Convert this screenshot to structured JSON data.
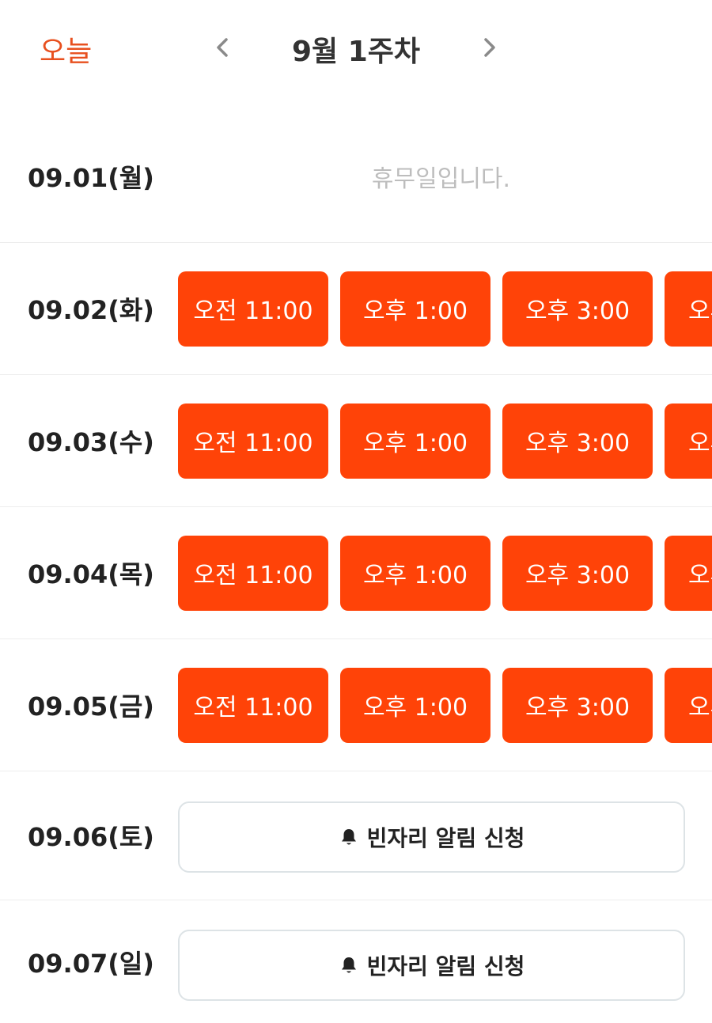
{
  "header": {
    "today_label": "오늘",
    "week_title": "9월 1주차",
    "prev_icon": "chevron-left-icon",
    "next_icon": "chevron-right-icon"
  },
  "colors": {
    "accent": "#ff4308",
    "today_text": "#e8501f",
    "closed_text": "#bdbdbd"
  },
  "days": [
    {
      "date": "09.01(월)",
      "status": "closed",
      "closed_text": "휴무일입니다."
    },
    {
      "date": "09.02(화)",
      "status": "open",
      "slots": [
        "오전 11:00",
        "오후 1:00",
        "오후 3:00",
        "오후"
      ]
    },
    {
      "date": "09.03(수)",
      "status": "open",
      "slots": [
        "오전 11:00",
        "오후 1:00",
        "오후 3:00",
        "오후"
      ]
    },
    {
      "date": "09.04(목)",
      "status": "open",
      "slots": [
        "오전 11:00",
        "오후 1:00",
        "오후 3:00",
        "오후"
      ]
    },
    {
      "date": "09.05(금)",
      "status": "open",
      "slots": [
        "오전 11:00",
        "오후 1:00",
        "오후 3:00",
        "오후"
      ]
    },
    {
      "date": "09.06(토)",
      "status": "full",
      "alarm_label": "빈자리 알림 신청",
      "alarm_icon": "bell-icon"
    },
    {
      "date": "09.07(일)",
      "status": "full",
      "alarm_label": "빈자리 알림 신청",
      "alarm_icon": "bell-icon"
    }
  ]
}
